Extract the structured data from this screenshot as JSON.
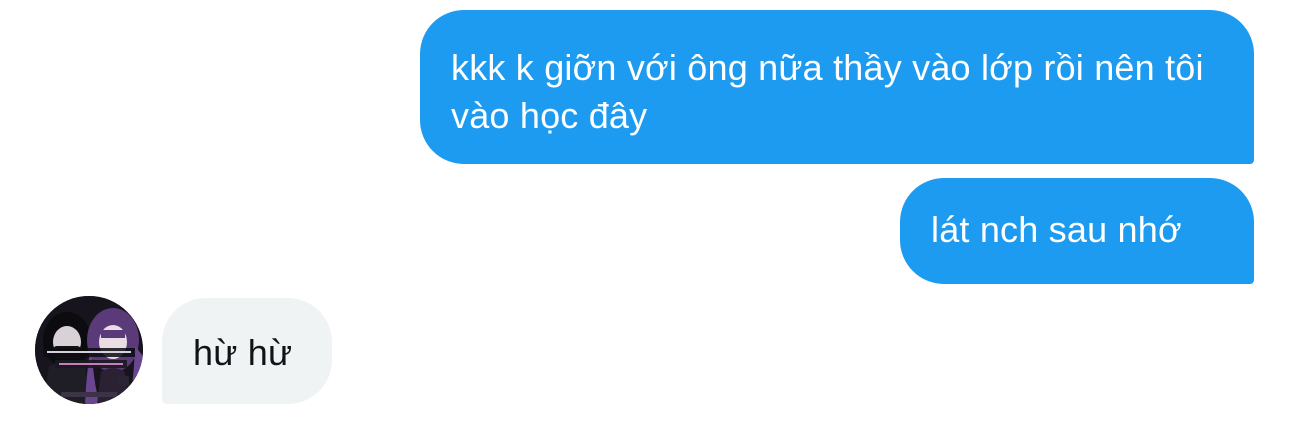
{
  "messages": [
    {
      "direction": "outgoing",
      "text": "kkk k giỡn với ông nữa thầy vào lớp rồi nên tôi vào học đây"
    },
    {
      "direction": "outgoing",
      "text": "lát nch sau nhớ"
    },
    {
      "direction": "incoming",
      "text": "hừ hừ"
    }
  ],
  "colors": {
    "outgoing_bubble": "#1d9bf0",
    "incoming_bubble": "#eff3f4",
    "outgoing_text": "#ffffff",
    "incoming_text": "#0f1419"
  }
}
